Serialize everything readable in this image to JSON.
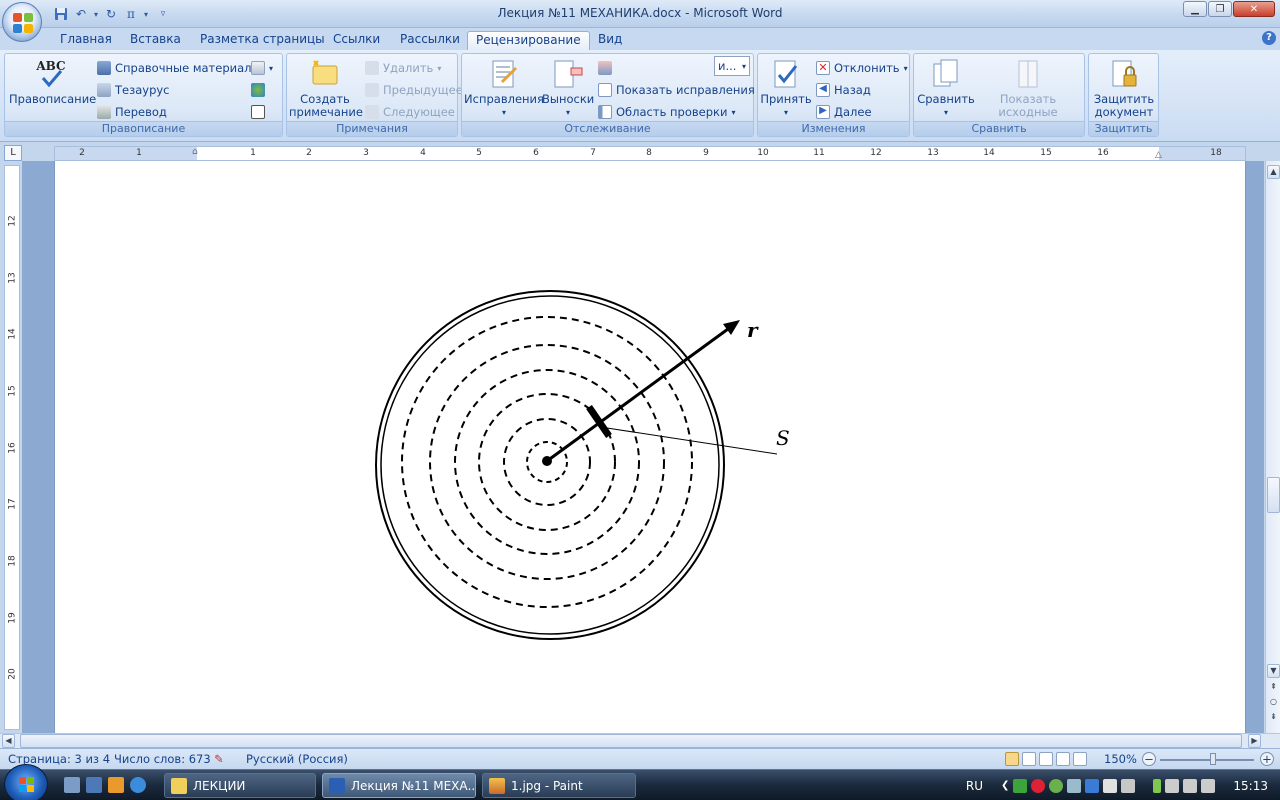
{
  "window": {
    "title": "Лекция №11 МЕХАНИКА.docx - Microsoft Word"
  },
  "tabs": [
    "Главная",
    "Вставка",
    "Разметка страницы",
    "Ссылки",
    "Рассылки",
    "Рецензирование",
    "Вид"
  ],
  "active_tab": "Рецензирование",
  "ribbon": {
    "proofing": {
      "label": "Правописание",
      "spelling": "Правописание",
      "research": "Справочные материалы",
      "thesaurus": "Тезаурус",
      "translate": "Перевод",
      "abc_icon_text": "ABC"
    },
    "comments": {
      "label": "Примечания",
      "new_comment": "Создать примечание",
      "delete": "Удалить",
      "previous": "Предыдущее",
      "next": "Следующее"
    },
    "tracking": {
      "label": "Отслеживание",
      "track_changes": "Исправления",
      "balloons": "Выноски",
      "display_select": "и...",
      "show_markup": "Показать исправления",
      "reviewing_pane": "Область проверки"
    },
    "changes": {
      "label": "Изменения",
      "accept": "Принять",
      "reject": "Отклонить",
      "previous": "Назад",
      "next": "Далее"
    },
    "compare": {
      "label": "Сравнить",
      "compare": "Сравнить",
      "show_source": "Показать исходные документы"
    },
    "protect": {
      "label": "Защитить",
      "protect_doc": "Защитить документ"
    }
  },
  "ruler": {
    "h_labels": [
      "2",
      "1",
      "1",
      "2",
      "3",
      "4",
      "5",
      "6",
      "7",
      "8",
      "9",
      "10",
      "11",
      "12",
      "13",
      "14",
      "15",
      "16",
      "18"
    ],
    "v_labels": [
      "12",
      "13",
      "14",
      "15",
      "16",
      "17",
      "18",
      "19",
      "20"
    ]
  },
  "diagram": {
    "label_r": "r",
    "label_s": "S"
  },
  "statusbar": {
    "page": "Страница: 3 из 4",
    "words": "Число слов: 673",
    "language": "Русский (Россия)",
    "zoom": "150%"
  },
  "taskbar": {
    "apps": [
      "ЛЕКЦИИ",
      "Лекция №11 МЕХА...",
      "1.jpg - Paint"
    ],
    "lang": "RU",
    "clock": "15:13"
  },
  "colors": {
    "ribbon_bg": "#d5e3f5",
    "text_blue": "#15428b",
    "doc_bg": "#8ba9d1"
  }
}
